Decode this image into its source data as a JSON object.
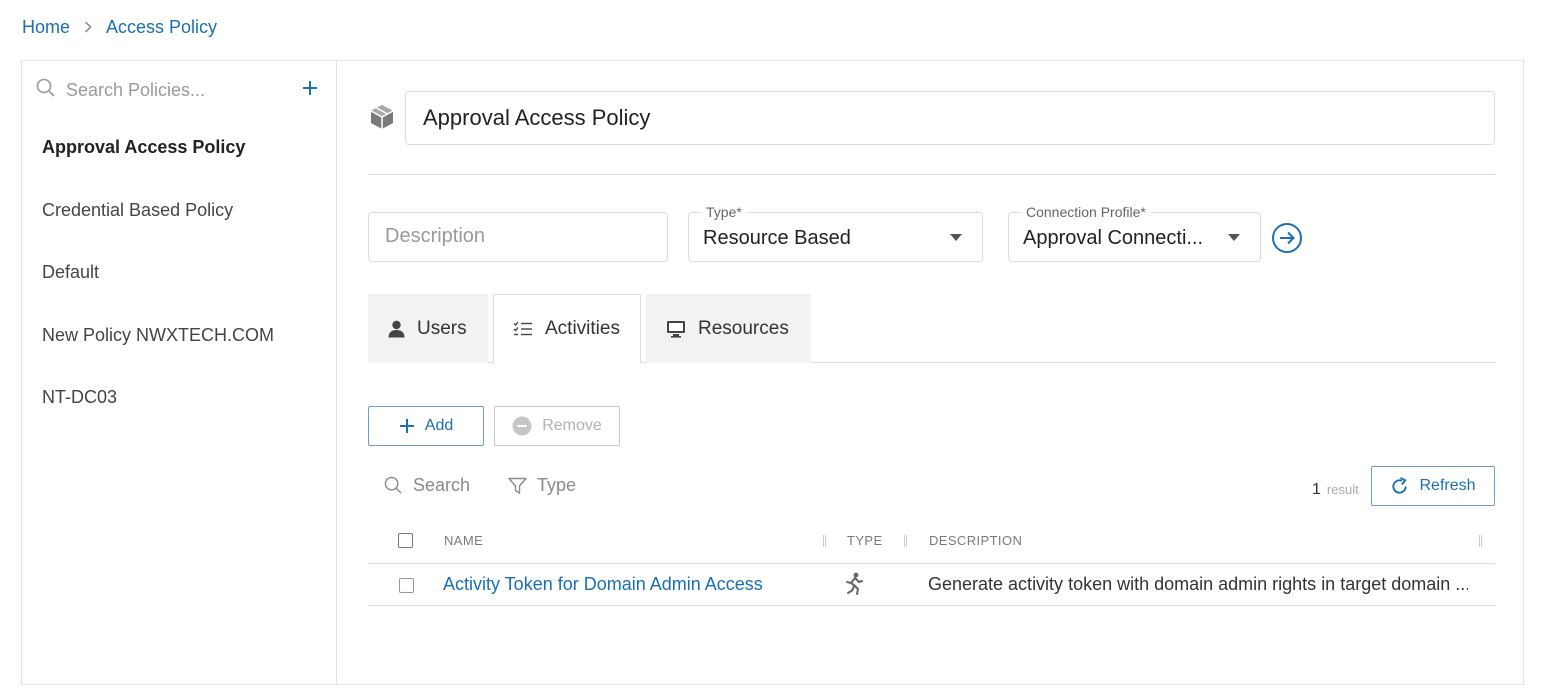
{
  "breadcrumb": {
    "home": "Home",
    "current": "Access Policy"
  },
  "sidebar": {
    "search_placeholder": "Search Policies...",
    "items": [
      {
        "label": "Approval Access Policy",
        "active": true
      },
      {
        "label": "Credential Based Policy"
      },
      {
        "label": "Default"
      },
      {
        "label": "New Policy NWXTECH.COM"
      },
      {
        "label": "NT-DC03"
      }
    ]
  },
  "policy": {
    "name": "Approval Access Policy",
    "description_placeholder": "Description",
    "type_label": "Type*",
    "type_value": "Resource Based",
    "connection_label": "Connection Profile*",
    "connection_value": "Approval Connecti..."
  },
  "tabs": [
    {
      "label": "Users",
      "icon": "user-icon"
    },
    {
      "label": "Activities",
      "icon": "checklist-icon",
      "active": true
    },
    {
      "label": "Resources",
      "icon": "monitor-icon"
    }
  ],
  "toolbar": {
    "add_label": "Add",
    "remove_label": "Remove",
    "refresh_label": "Refresh"
  },
  "filters": {
    "search_label": "Search",
    "type_label": "Type"
  },
  "results": {
    "count": "1",
    "label": "result"
  },
  "table": {
    "headers": {
      "name": "NAME",
      "type": "TYPE",
      "description": "DESCRIPTION"
    },
    "rows": [
      {
        "name": "Activity Token for Domain Admin Access",
        "type_icon": "running-person-icon",
        "description": "Generate activity token with domain admin rights in target domain ..."
      }
    ]
  },
  "colors": {
    "accent": "#1a6fb5",
    "border": "#dcdcdc",
    "tab_inactive": "#f2f2f2"
  }
}
